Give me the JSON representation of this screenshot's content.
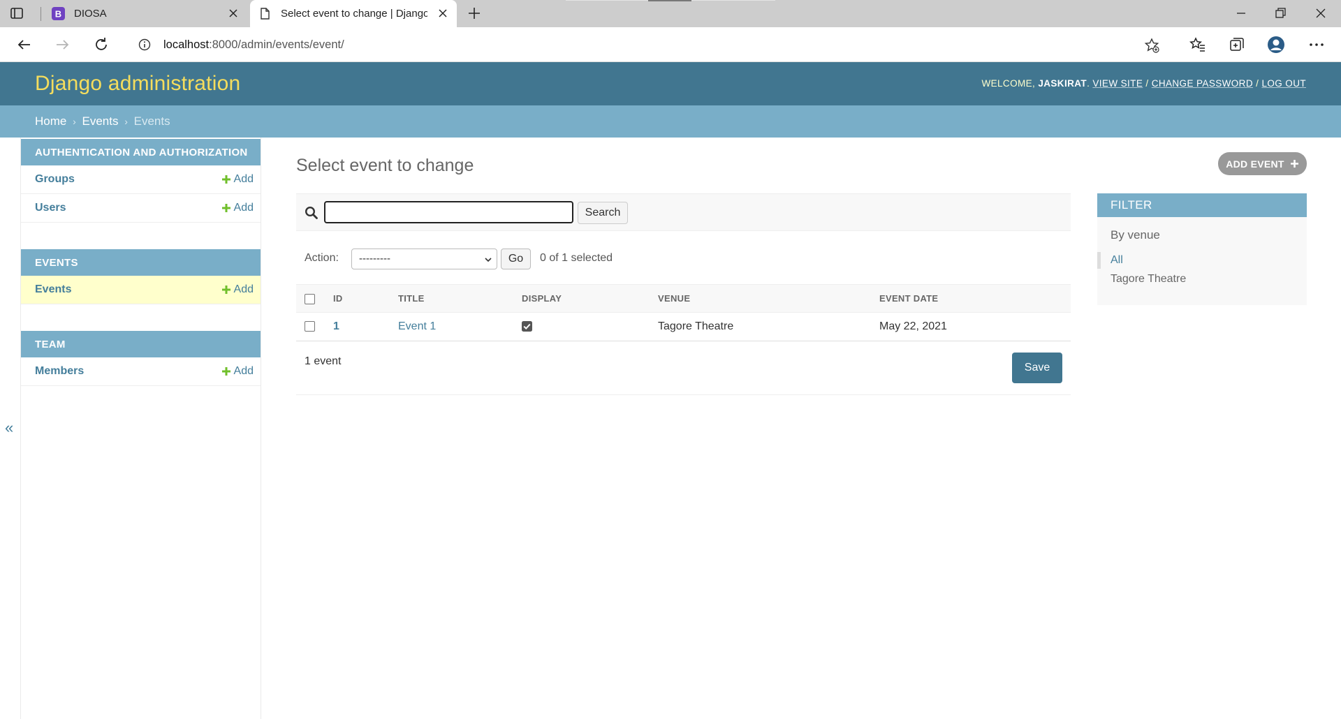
{
  "browser": {
    "tabs": [
      {
        "title": "DIOSA",
        "favicon_letter": "B"
      },
      {
        "title": "Select event to change | Django"
      }
    ],
    "url_host": "localhost",
    "url_path": ":8000/admin/events/event/"
  },
  "header": {
    "brand": "Django administration",
    "welcome": "WELCOME,",
    "username": "JASKIRAT",
    "view_site": "VIEW SITE",
    "change_password": "CHANGE PASSWORD",
    "log_out": "LOG OUT",
    "sep": "/"
  },
  "breadcrumbs": {
    "home": "Home",
    "app": "Events",
    "current": "Events",
    "sep": "›"
  },
  "sidebar": {
    "modules": [
      {
        "caption": "AUTHENTICATION AND AUTHORIZATION",
        "models": [
          {
            "name": "Groups",
            "add": "Add"
          },
          {
            "name": "Users",
            "add": "Add"
          }
        ]
      },
      {
        "caption": "EVENTS",
        "models": [
          {
            "name": "Events",
            "add": "Add"
          }
        ]
      },
      {
        "caption": "TEAM",
        "models": [
          {
            "name": "Members",
            "add": "Add"
          }
        ]
      }
    ],
    "collapse": "«"
  },
  "main": {
    "title": "Select event to change",
    "add_button": "ADD EVENT",
    "search_button": "Search",
    "search_value": "",
    "action_label": "Action:",
    "action_selected": "---------",
    "go_button": "Go",
    "counter": "0 of 1 selected",
    "columns": [
      "ID",
      "TITLE",
      "DISPLAY",
      "VENUE",
      "EVENT DATE"
    ],
    "rows": [
      {
        "id": "1",
        "title": "Event 1",
        "display": true,
        "venue": "Tagore Theatre",
        "event_date": "May 22, 2021"
      }
    ],
    "result_count": "1 event",
    "save_button": "Save"
  },
  "filter": {
    "caption": "FILTER",
    "heading": "By venue",
    "items": [
      "All",
      "Tagore Theatre"
    ]
  },
  "colors": {
    "header_bg": "#417690",
    "brand": "#f5dd5d",
    "breadcrumb_bg": "#79aec8",
    "link": "#447e9b",
    "current_row": "#ffffcc"
  }
}
